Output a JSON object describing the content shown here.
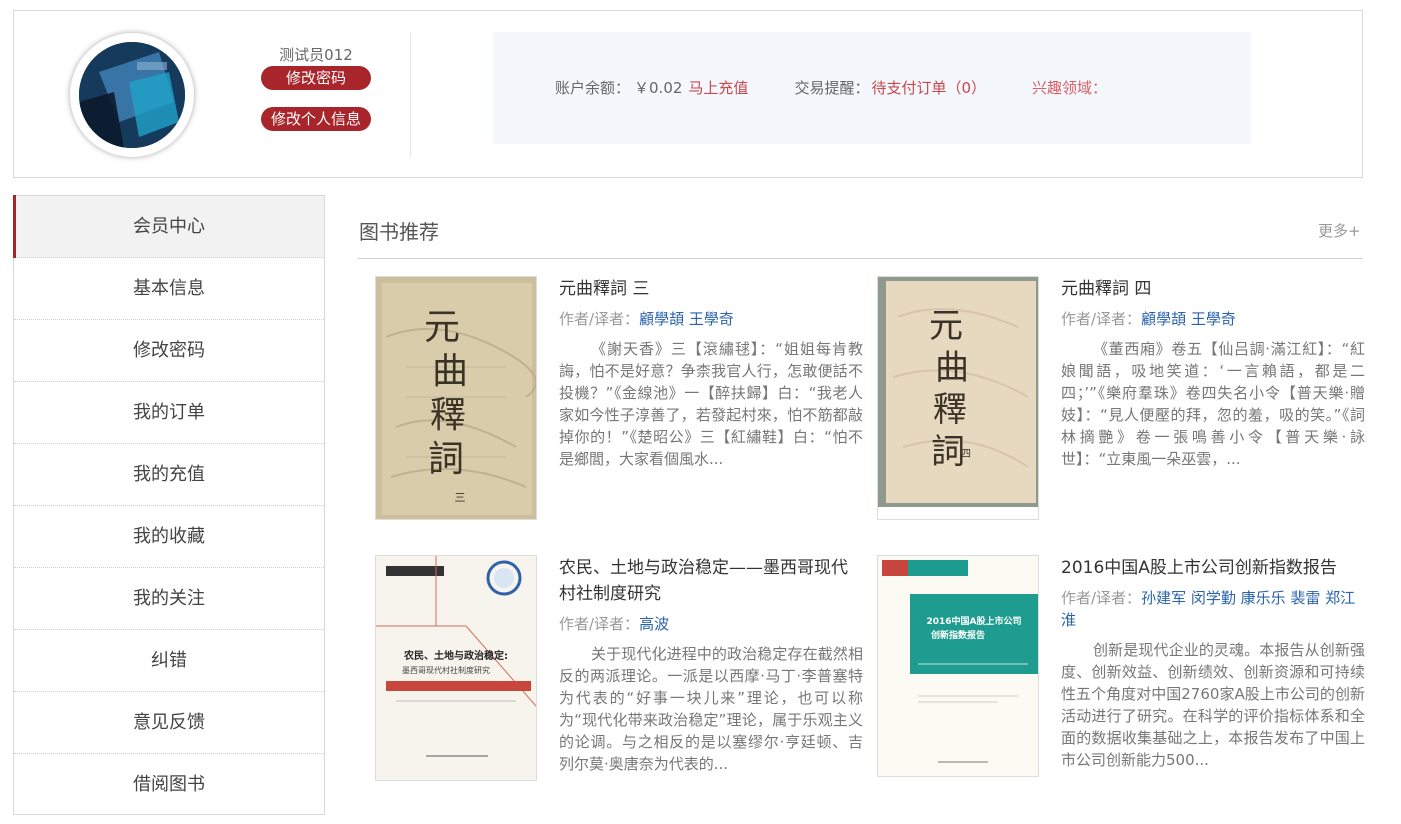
{
  "user": {
    "username": "测试员012",
    "change_password_label": "修改密码",
    "edit_profile_label": "修改个人信息"
  },
  "account": {
    "balance_label": "账户余额：",
    "balance_value": "￥0.02",
    "recharge_label": "马上充值",
    "trade_label": "交易提醒：",
    "pending_orders_label": "待支付订单（0）",
    "interest_label": "兴趣领域："
  },
  "sidebar": {
    "items": [
      {
        "label": "会员中心"
      },
      {
        "label": "基本信息"
      },
      {
        "label": "修改密码"
      },
      {
        "label": "我的订单"
      },
      {
        "label": "我的充值"
      },
      {
        "label": "我的收藏"
      },
      {
        "label": "我的关注"
      },
      {
        "label": "纠错"
      },
      {
        "label": "意见反馈"
      },
      {
        "label": "借阅图书"
      }
    ]
  },
  "recommend": {
    "title": "图书推荐",
    "more_label": "更多+",
    "author_prefix": "作者/译者：",
    "books": [
      {
        "title": "元曲釋詞 三",
        "authors": "顧學頡 王學奇",
        "description": "《謝天香》三【滾繡毬】：“姐姐每肯教誨，怕不是好意？争柰我官人行，怎敢便話不投機？”《金線池》一【醉扶歸】白：“我老人家如今性子淳善了，若發起村來，怕不筋都敲掉你的！”《楚昭公》三【紅繡鞋】白：“怕不是鄉閭，大家看個風水..."
      },
      {
        "title": "元曲釋詞 四",
        "authors": "顧學頡 王學奇",
        "description": "《董西廂》卷五【仙吕調·滿江紅】：“紅娘聞語，吸地笑道：‘一言賴語，都是二四；’”《樂府羣珠》卷四失名小令【普天樂·贈妓】：“見人便壓的拜，忽的羞，吸的笑。”《詞林摘艷》卷一張鳴善小令【普天樂·詠世】：“立東風一朵巫雲，..."
      },
      {
        "title": "农民、土地与政治稳定——墨西哥现代村社制度研究",
        "authors": "高波",
        "description": "关于现代化进程中的政治稳定存在截然相反的两派理论。一派是以西摩·马丁·李普塞特为代表的“好事一块儿来”理论，也可以称为“现代化带来政治稳定”理论，属于乐观主义的论调。与之相反的是以塞缪尔·亨廷顿、吉列尔莫·奥唐奈为代表的..."
      },
      {
        "title": "2016中国A股上市公司创新指数报告",
        "authors": "孙建军 闵学勤 康乐乐 裴雷 郑江淮",
        "description": "创新是现代企业的灵魂。本报告从创新强度、创新效益、创新绩效、创新资源和可持续性五个角度对中国2760家A股上市公司的创新活动进行了研究。在科学的评价指标体系和全面的数据收集基础之上，本报告发布了中国上市公司创新能力500..."
      }
    ]
  },
  "covers": {
    "book1": {
      "big_text": [
        "元",
        "曲",
        "釋",
        "詞"
      ],
      "volume": "三"
    },
    "book2": {
      "big_text": [
        "元",
        "曲",
        "釋",
        "詞"
      ],
      "volume": "四"
    },
    "book3": {
      "title_line1": "农民、土地与政治稳定:",
      "title_line2": "墨西哥现代村社制度研究"
    },
    "book4": {
      "title_line1": "2016中国A股上市公司",
      "title_line2": "创新指数报告"
    }
  }
}
